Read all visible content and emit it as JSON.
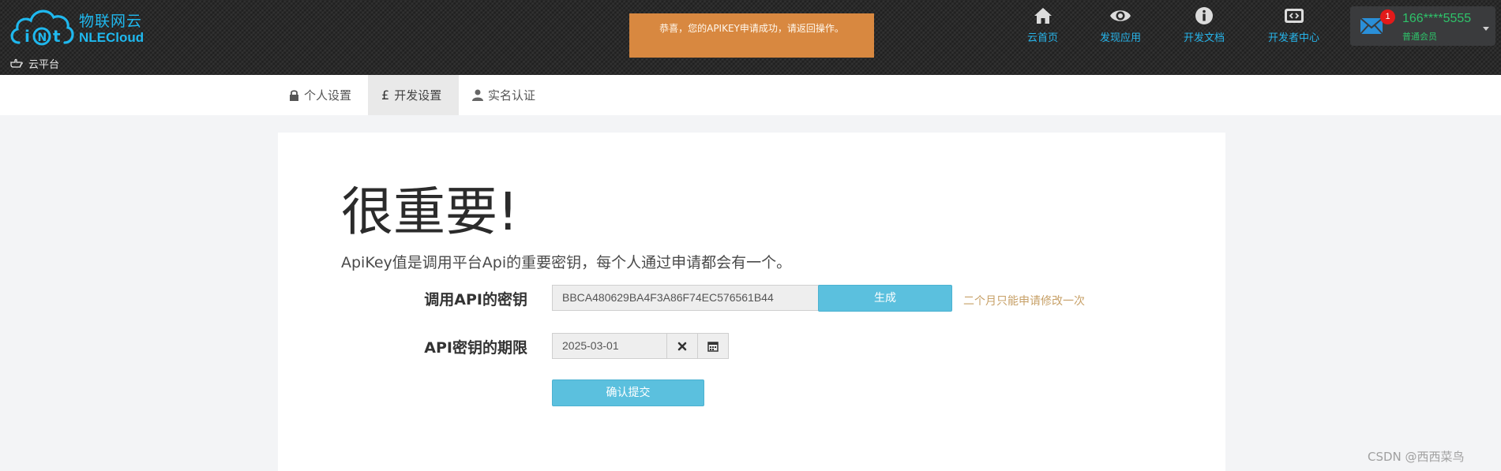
{
  "header": {
    "logo_mark_text": "iot",
    "logo_cn": "物联网云",
    "logo_en": "NLECloud",
    "breadcrumb": "云平台",
    "toast": "恭喜，您的APIKEY申请成功，请返回操作。",
    "nav": [
      {
        "label": "云首页",
        "icon": "home-icon"
      },
      {
        "label": "发现应用",
        "icon": "eye-icon"
      },
      {
        "label": "开发文档",
        "icon": "info-icon"
      },
      {
        "label": "开发者中心",
        "icon": "developer-icon"
      }
    ],
    "user": {
      "badge_count": "1",
      "name": "166****5555",
      "role": "普通会员"
    }
  },
  "tabs": [
    {
      "label": "个人设置",
      "icon": "lock-icon",
      "active": false
    },
    {
      "label": "开发设置",
      "icon": "pound-icon",
      "active": true
    },
    {
      "label": "实名认证",
      "icon": "user-icon",
      "active": false
    }
  ],
  "main": {
    "title": "很重要!",
    "description": "ApiKey值是调用平台Api的重要密钥，每个人通过申请都会有一个。",
    "apikey": {
      "label": "调用API的密钥",
      "value": "BBCA480629BA4F3A86F74EC576561B44",
      "generate_label": "生成",
      "hint": "二个月只能申请修改一次"
    },
    "expiry": {
      "label": "API密钥的期限",
      "value": "2025-03-01"
    },
    "submit_label": "确认提交"
  },
  "watermark": "CSDN @西西菜鸟",
  "colors": {
    "accent": "#27b4ea",
    "toast": "#d88840",
    "button": "#5bc0de",
    "user_green": "#2ec36a",
    "badge_red": "#e31a1a"
  }
}
